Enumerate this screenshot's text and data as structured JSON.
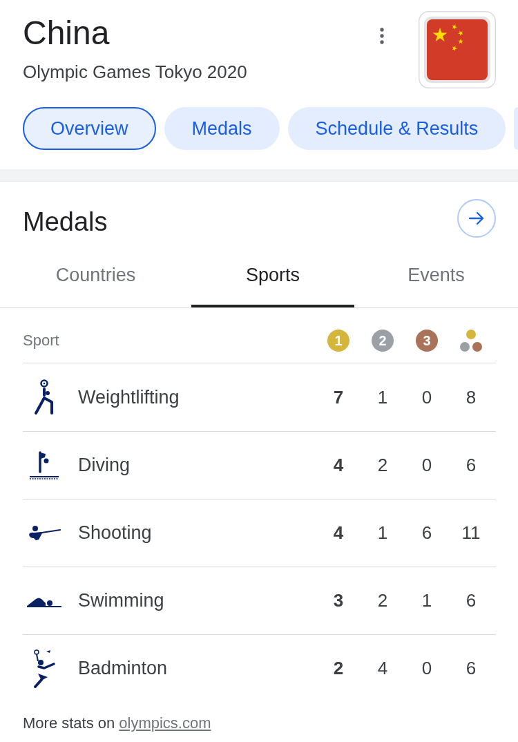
{
  "header": {
    "title": "China",
    "subtitle": "Olympic Games Tokyo 2020"
  },
  "chips": [
    {
      "label": "Overview",
      "selected": true
    },
    {
      "label": "Medals",
      "selected": false
    },
    {
      "label": "Schedule & Results",
      "selected": false
    },
    {
      "selected": false
    }
  ],
  "medals": {
    "title": "Medals",
    "tabs": [
      {
        "label": "Countries",
        "selected": false
      },
      {
        "label": "Sports",
        "selected": true
      },
      {
        "label": "Events",
        "selected": false
      }
    ],
    "table": {
      "columns": [
        {
          "kind": "text",
          "label": "Sport"
        },
        {
          "kind": "medal",
          "label": "1",
          "color": "#d5b53c"
        },
        {
          "kind": "medal",
          "label": "2",
          "color": "#9aa0a6"
        },
        {
          "kind": "medal",
          "label": "3",
          "color": "#a97259"
        },
        {
          "kind": "total"
        }
      ],
      "rows": [
        {
          "kind": "weightlifting",
          "sport": "Weightlifting",
          "counts": [
            "7",
            "1",
            "0",
            "8"
          ]
        },
        {
          "kind": "diving",
          "sport": "Diving",
          "counts": [
            "4",
            "2",
            "0",
            "6"
          ]
        },
        {
          "kind": "shooting",
          "sport": "Shooting",
          "counts": [
            "4",
            "1",
            "6",
            "11"
          ]
        },
        {
          "kind": "swimming",
          "sport": "Swimming",
          "counts": [
            "3",
            "2",
            "1",
            "6"
          ]
        },
        {
          "kind": "badminton",
          "sport": "Badminton",
          "counts": [
            "2",
            "4",
            "0",
            "6"
          ]
        }
      ]
    }
  },
  "footer": {
    "text": "More stats on",
    "link": "olympics.com"
  }
}
